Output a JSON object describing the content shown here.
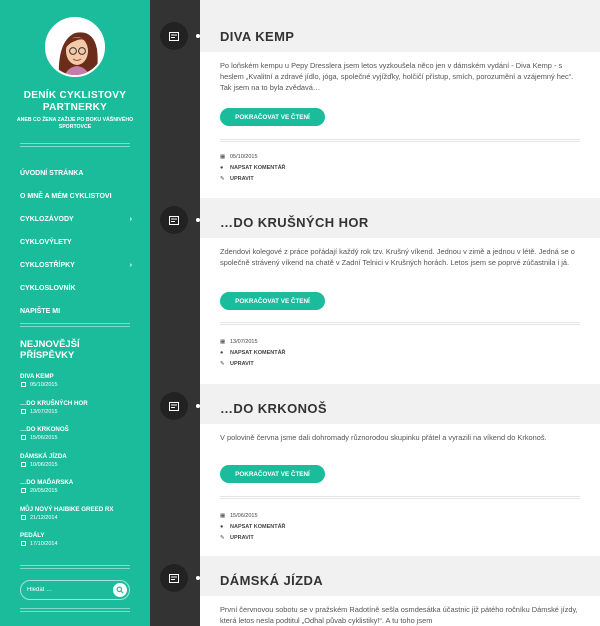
{
  "site": {
    "title": "DENÍK CYKLISTOVY PARTNERKY",
    "description": "ANEB CO ŽENA ZAŽIJE PO BOKU VÁŠNIVÉHO SPORTOVCE"
  },
  "nav": {
    "items": [
      {
        "label": "ÚVODNÍ STRÁNKA",
        "submenu": false
      },
      {
        "label": "O MNĚ A MÉM CYKLISTOVI",
        "submenu": false
      },
      {
        "label": "CYKLOZÁVODY",
        "submenu": true
      },
      {
        "label": "CYKLOVÝLETY",
        "submenu": false
      },
      {
        "label": "CYKLOSTŘÍPKY",
        "submenu": true
      },
      {
        "label": "CYKLOSLOVNÍK",
        "submenu": false
      },
      {
        "label": "NAPIŠTE MI",
        "submenu": false
      }
    ],
    "chevron": "›"
  },
  "recent": {
    "title": "NEJNOVĚJŠÍ PŘÍSPĚVKY",
    "items": [
      {
        "title": "DIVA KEMP",
        "date": "05/10/2015"
      },
      {
        "title": "…DO KRUŠNÝCH HOR",
        "date": "13/07/2015"
      },
      {
        "title": "…DO KRKONOŠ",
        "date": "15/06/2015"
      },
      {
        "title": "DÁMSKÁ JÍZDA",
        "date": "10/06/2015"
      },
      {
        "title": "…DO MAĎARSKA",
        "date": "20/05/2015"
      },
      {
        "title": "MŮJ NOVÝ HAIBIKE GREED RX",
        "date": "21/12/2014"
      },
      {
        "title": "PEDÁLY",
        "date": "17/10/2014"
      }
    ]
  },
  "search": {
    "placeholder": "Hledat …"
  },
  "posts": [
    {
      "title": "DIVA KEMP",
      "excerpt": "Po loňském kempu u Pepy Dresslera jsem letos vyzkoušela něco jen v dámském vydání - Diva Kemp - s heslem „Kvalitní a zdravé jídlo, jóga, společné vyjížďky, holčičí přístup, smích, porozumění a vzájemný hec“. Tak jsem na to byla zvědavá…",
      "more": "POKRAČOVAT VE ČTENÍ",
      "date": "05/10/2015",
      "comment": "NAPSAT KOMENTÁŘ",
      "edit": "UPRAVIT"
    },
    {
      "title": "…DO KRUŠNÝCH HOR",
      "excerpt": "Zdendovi kolegové z práce pořádají každý rok tzv. Krušný víkend. Jednou v zimě a jednou v létě. Jedná se o společně strávený víkend na chatě v Zadní Telnici v Krušných horách. Letos jsem se poprvé zúčastnila i já.",
      "more": "POKRAČOVAT VE ČTENÍ",
      "date": "13/07/2015",
      "comment": "NAPSAT KOMENTÁŘ",
      "edit": "UPRAVIT"
    },
    {
      "title": "…DO KRKONOŠ",
      "excerpt": "V polovině června jsme dali dohromady různorodou skupinku přátel a vyrazili na víkend do Krkonoš.",
      "more": "POKRAČOVAT VE ČTENÍ",
      "date": "15/06/2015",
      "comment": "NAPSAT KOMENTÁŘ",
      "edit": "UPRAVIT"
    },
    {
      "title": "DÁMSKÁ JÍZDA",
      "excerpt": "První červnovou sobotu se v pražském Radotíně sešla osmdesátka účastnic již pátého ročníku Dámské jízdy, která letos nesla podtitul „Odhal půvab cyklistiky!“. A tu toho jsem"
    }
  ]
}
